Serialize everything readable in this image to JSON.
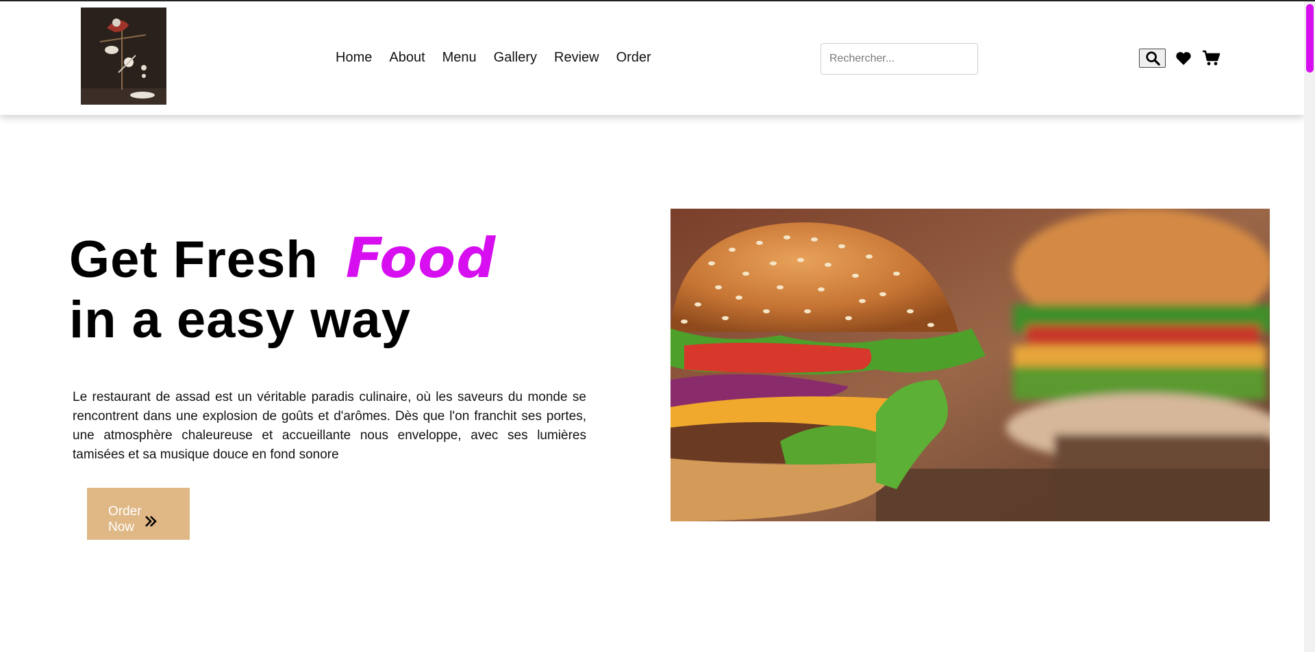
{
  "header": {
    "nav": [
      "Home",
      "About",
      "Menu",
      "Gallery",
      "Review",
      "Order"
    ],
    "search_placeholder": "Rechercher...",
    "icons": [
      "search-icon",
      "heart-icon",
      "cart-icon"
    ]
  },
  "hero": {
    "title_part1": "Get Fresh",
    "title_accent": "Food",
    "title_line2": "in a easy way",
    "description": "Le restaurant de assad est un véritable paradis culinaire, où les saveurs du monde se rencontrent dans une explosion de goûts et d'arômes. Dès que l'on franchit ses portes, une atmosphère chaleureuse et accueillante nous enveloppe, avec ses lumières tamisées et sa musique douce en fond sonore",
    "order_button": {
      "line1": "Order",
      "line2": "Now"
    }
  },
  "colors": {
    "accent": "#d60ef0",
    "button_bg": "#dfb886",
    "scrollbar_thumb": "#d60ef0"
  }
}
